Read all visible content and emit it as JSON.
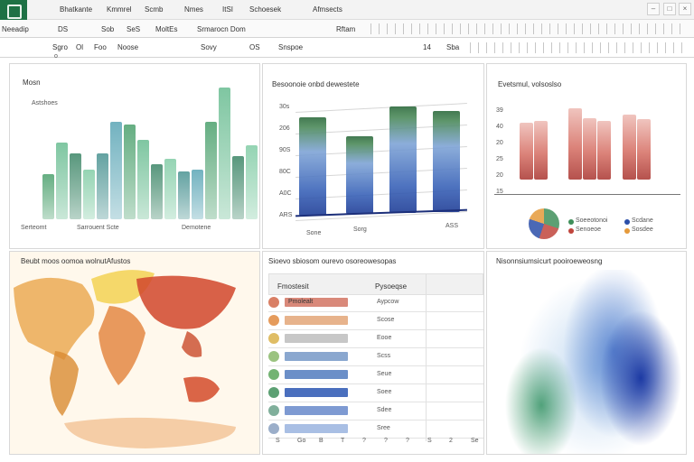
{
  "menu": {
    "items": [
      "Bhatkante",
      "Kmmrel",
      "Scmb",
      "Nmes",
      "ItSI",
      "Schoesek",
      "Afmsects"
    ]
  },
  "formula_bar": {
    "name_box": "Neeadip",
    "segments": [
      "DS",
      "Sob",
      "SeS",
      "MoltEs",
      "Srmarocn Dom",
      "Rftam"
    ]
  },
  "toolbar2": {
    "items": [
      "Sgro",
      "Ol",
      "Foo",
      "Noose",
      "Sovy",
      "OS",
      "Snspoe",
      "14",
      "Sba"
    ],
    "cell": "o"
  },
  "colors": {
    "green": "#2e8b57",
    "blue": "#2b4ea8",
    "red": "#c0453c",
    "accent_app": "#1e7145"
  },
  "panel1": {
    "title": "Mosn",
    "subtitle": "Astshoes",
    "x_labels": [
      "Serteomt",
      "Sarrouent Scte",
      "Demotene"
    ],
    "chart_data": {
      "type": "bar",
      "values": [
        34,
        58,
        50,
        38,
        50,
        74,
        72,
        60,
        42,
        46,
        36,
        38,
        74,
        100,
        48,
        56
      ]
    }
  },
  "panel2": {
    "title": "Besoonoie onbd dewestete",
    "y_ticks": [
      "30s",
      "206",
      "90S",
      "80C",
      "A0C",
      "ARS"
    ],
    "x_labels": [
      "Sone",
      "Sorg",
      "ASS"
    ],
    "chart_data": {
      "type": "bar",
      "values": [
        78,
        62,
        84,
        80
      ],
      "y_ticks": [
        "30s",
        "206",
        "90S",
        "80C",
        "A0C",
        "ARS"
      ]
    }
  },
  "panel3": {
    "title": "Evetsmul, volsoslso",
    "y_ticks": [
      "39",
      "40",
      "20",
      "25",
      "20",
      "15"
    ],
    "legend": [
      "Soeeotonoi",
      "Senoeoe",
      "Scdane",
      "Sosdee"
    ],
    "chart_data": {
      "type": "bar",
      "values": [
        70,
        72,
        88,
        76,
        72,
        80,
        74
      ]
    }
  },
  "panel4": {
    "title": "Beubt moos oomoa wolnutAfustos"
  },
  "panel5": {
    "title": "Sioevo sbiosom ourevo osoreowesopas",
    "col1": "Fmostesit",
    "col2": "Pysoeqse",
    "rows": [
      {
        "label": "Pmolealt",
        "value": "Aypcow"
      },
      {
        "label": "",
        "value": "Scose"
      },
      {
        "label": "",
        "value": "Eooe"
      },
      {
        "label": "",
        "value": "Scss"
      },
      {
        "label": "",
        "value": "Seue"
      },
      {
        "label": "",
        "value": "Soee"
      },
      {
        "label": "",
        "value": "Sdee"
      },
      {
        "label": "",
        "value": "Sree"
      }
    ],
    "footer": [
      "S",
      "Go",
      "B",
      "T",
      "?",
      "?",
      "?",
      "S",
      "2",
      "Se"
    ]
  },
  "panel6": {
    "title": "Nisonnsiumsicurt pooiroeweosng"
  }
}
